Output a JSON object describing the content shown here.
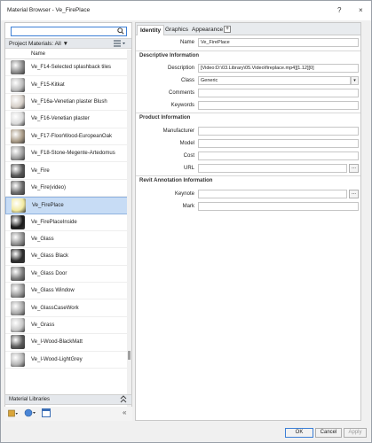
{
  "window": {
    "title": "Material Browser - Ve_FirePlace",
    "help": "?",
    "close": "×"
  },
  "search": {
    "value": "",
    "placeholder": ""
  },
  "project_materials": {
    "label": "Project Materials: All ▼",
    "filter_icon": "funnel-icon",
    "view_icon": "list-view-icon"
  },
  "list": {
    "header": "Name",
    "items": [
      {
        "label": "Ve_F14-Selected splashback tiles",
        "color": "#8a8a8a"
      },
      {
        "label": "Ve_F15-Kitkat",
        "color": "#bcbcbc"
      },
      {
        "label": "Ve_F16a-Venetian plaster Blush",
        "color": "#d6cfc8"
      },
      {
        "label": "Ve_F16-Venetian plaster",
        "color": "#d9d9d9"
      },
      {
        "label": "Ve_F17-FloorWood-EuropeanOak",
        "color": "#a89a86"
      },
      {
        "label": "Ve_F18-Stone-Megente-Artedomus",
        "color": "#9d9d9d"
      },
      {
        "label": "Ve_Fire",
        "color": "#555555"
      },
      {
        "label": "Ve_Fire(video)",
        "color": "#6a6a6a"
      },
      {
        "label": "Ve_FirePlace",
        "color": "#f2eaa0"
      },
      {
        "label": "Ve_FirePlaceInside",
        "color": "#1a1a1a"
      },
      {
        "label": "Ve_Glass",
        "color": "#8f8f8f"
      },
      {
        "label": "Ve_Glass Black",
        "color": "#2b2b2b"
      },
      {
        "label": "Ve_Glass Door",
        "color": "#7c7c7c"
      },
      {
        "label": "Ve_Glass Window",
        "color": "#9a9a9a"
      },
      {
        "label": "Ve_GlassCaseWork",
        "color": "#a9a9a9"
      },
      {
        "label": "Ve_Grass",
        "color": "#c8c8c8"
      },
      {
        "label": "Ve_I-Wood-BlackMatt",
        "color": "#5a5a5a"
      },
      {
        "label": "Ve_I-Wood-LightGrey",
        "color": "#b5b5b5"
      }
    ],
    "selected_index": 8
  },
  "material_libraries": {
    "label": "Material Libraries",
    "collapse_icon": "double-chevron-up-icon"
  },
  "tools": {
    "library_icon": "library-icon",
    "globe_icon": "globe-icon",
    "editor_icon": "editor-window-icon",
    "collapse": "«"
  },
  "tabs": [
    {
      "label": "Identity"
    },
    {
      "label": "Graphics"
    },
    {
      "label": "Appearance"
    },
    {
      "label": "+"
    }
  ],
  "identity": {
    "name_label": "Name",
    "name_value": "Ve_FirePlace",
    "descriptive_header": "Descriptive Information",
    "description_label": "Description",
    "description_value": "[Video:D:\\03.Library\\05.Video\\fireplace.mp4][1.12][0]",
    "class_label": "Class",
    "class_value": "Generic",
    "comments_label": "Comments",
    "comments_value": "",
    "keywords_label": "Keywords",
    "keywords_value": "",
    "product_header": "Product Information",
    "manufacturer_label": "Manufacturer",
    "manufacturer_value": "",
    "model_label": "Model",
    "model_value": "",
    "cost_label": "Cost",
    "cost_value": "",
    "url_label": "URL",
    "url_value": "",
    "url_browse": "...",
    "revit_header": "Revit Annotation Information",
    "keynote_label": "Keynote",
    "keynote_value": "",
    "keynote_browse": "...",
    "mark_label": "Mark",
    "mark_value": ""
  },
  "buttons": {
    "ok": "OK",
    "cancel": "Cancel",
    "apply": "Apply"
  }
}
